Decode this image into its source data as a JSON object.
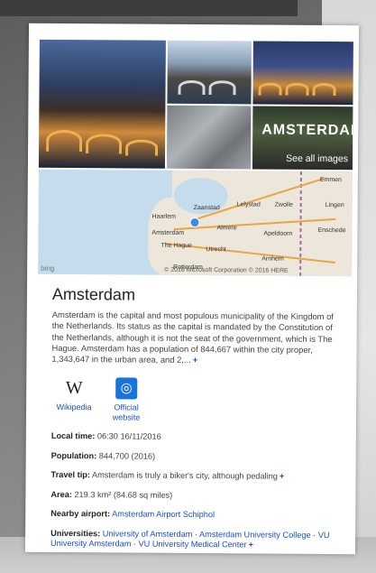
{
  "images": {
    "overlay_word": "AMSTERDAM",
    "see_all_label": "See all images"
  },
  "map": {
    "cities": [
      "Emmen",
      "Lingen",
      "Zwolle",
      "Lelystad",
      "Zaanstad",
      "Haarlem",
      "Almere",
      "Amsterdam",
      "Apeldoorn",
      "Enschede",
      "The Hague",
      "Utrecht",
      "Arnhem",
      "Rotterdam"
    ],
    "provider": "bing",
    "attribution": "© 2016 Microsoft Corporation © 2016 HERE"
  },
  "entity": {
    "title": "Amsterdam",
    "description": "Amsterdam is the capital and most populous municipality of the Kingdom of the Netherlands. Its status as the capital is mandated by the Constitution of the Netherlands, although it is not the seat of the government, which is The Hague. Amsterdam has a population of 844,667 within the city proper, 1,343,647 in the urban area, and 2,...",
    "more": "+"
  },
  "links": {
    "wikipedia_label": "Wikipedia",
    "website_label": "Official website"
  },
  "facts": {
    "local_time_label": "Local time:",
    "local_time_value": "06:30 16/11/2016",
    "population_label": "Population:",
    "population_value": "844,700 (2016)",
    "travel_tip_label": "Travel tip:",
    "travel_tip_value": "Amsterdam is truly a biker's city, although pedaling",
    "area_label": "Area:",
    "area_value": "219.3 km² (84.68 sq miles)",
    "airport_label": "Nearby airport:",
    "airport_value": "Amsterdam Airport Schiphol",
    "universities_label": "Universities:",
    "universities": [
      "University of Amsterdam",
      "Amsterdam University College",
      "VU University Amsterdam",
      "VU University Medical Center"
    ]
  },
  "colors": {
    "link": "#1a4fc9",
    "accent_blue": "#1a73d9"
  }
}
